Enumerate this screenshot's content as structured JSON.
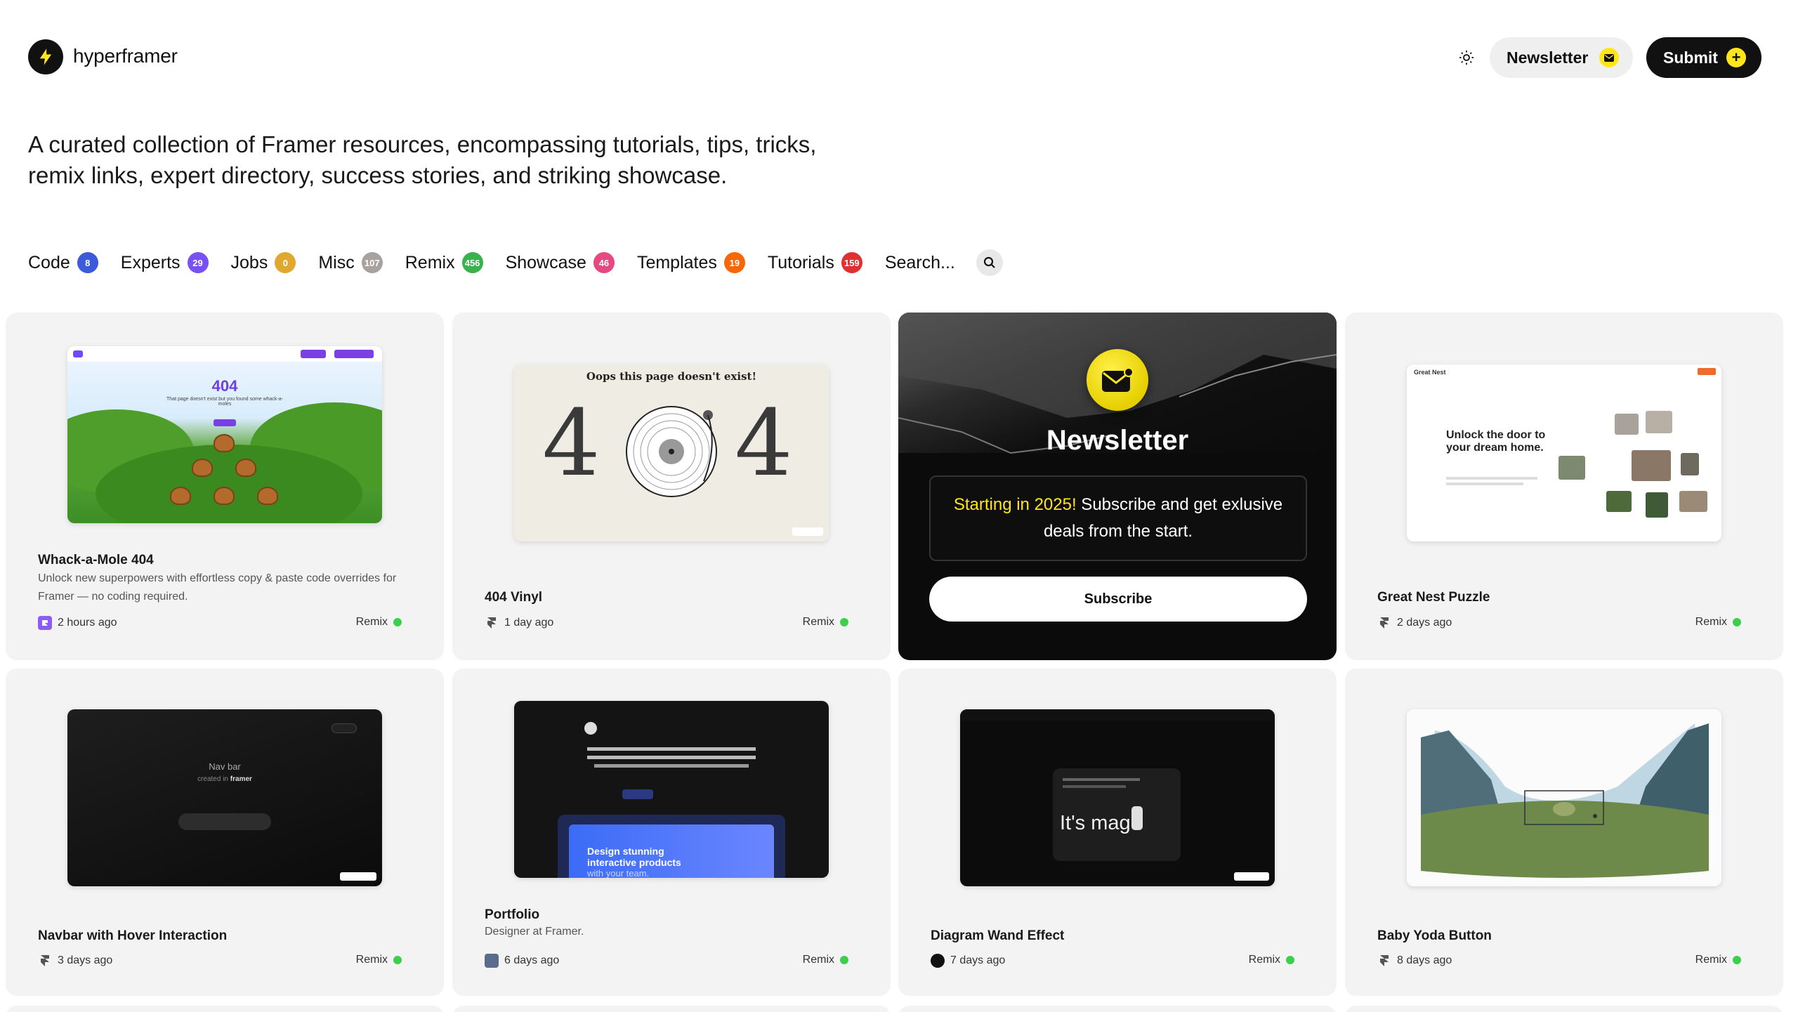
{
  "header": {
    "brand": "hyperframer",
    "newsletter_label": "Newsletter",
    "submit_label": "Submit"
  },
  "tagline": "A curated collection of Framer resources, encompassing tutorials, tips, tricks, remix links, expert directory, success stories, and striking showcase.",
  "filters": [
    {
      "label": "Code",
      "count": "8",
      "color": "#3b5bdb"
    },
    {
      "label": "Experts",
      "count": "29",
      "color": "#7950f2"
    },
    {
      "label": "Jobs",
      "count": "0",
      "color": "#e0a82e"
    },
    {
      "label": "Misc",
      "count": "107",
      "color": "#a8a29e"
    },
    {
      "label": "Remix",
      "count": "456",
      "color": "#37b24d"
    },
    {
      "label": "Showcase",
      "count": "46",
      "color": "#e64980"
    },
    {
      "label": "Templates",
      "count": "19",
      "color": "#f76707"
    },
    {
      "label": "Tutorials",
      "count": "159",
      "color": "#e03131"
    }
  ],
  "search": {
    "label": "Search..."
  },
  "newsletter_card": {
    "title": "Newsletter",
    "highlight": "Starting in 2025!",
    "body": " Subscribe and get exlusive deals from the start.",
    "button": "Subscribe"
  },
  "cards": [
    {
      "title": "Whack-a-Mole 404",
      "desc": "Unlock new superpowers with effortless copy & paste code overrides for Framer — no coding required.",
      "time": "2 hours ago",
      "tag": "Remix"
    },
    {
      "title": "404 Vinyl",
      "desc": "",
      "time": "1 day ago",
      "tag": "Remix"
    },
    {
      "title": "Great Nest Puzzle",
      "desc": "",
      "time": "2 days ago",
      "tag": "Remix"
    },
    {
      "title": "Navbar with Hover Interaction",
      "desc": "",
      "time": "3 days ago",
      "tag": "Remix"
    },
    {
      "title": "Portfolio",
      "desc": "Designer at Framer.",
      "time": "6 days ago",
      "tag": "Remix"
    },
    {
      "title": "Diagram Wand Effect",
      "desc": "",
      "time": "7 days ago",
      "tag": "Remix"
    },
    {
      "title": "Baby Yoda Button",
      "desc": "",
      "time": "8 days ago",
      "tag": "Remix"
    }
  ],
  "thumbs": {
    "whack": {
      "heading": "404",
      "line": "That page doesn't exist but you found some whack-a-moles"
    },
    "vinyl": {
      "heading": "Oops this page doesn't exist!",
      "big_left": "4",
      "big_right": "4"
    },
    "puzzle": {
      "brand": "Great Nest",
      "heading": "Unlock the door to your dream home."
    },
    "navbar": {
      "line1": "Nav bar",
      "line2": "created in",
      "line3": "framer"
    },
    "portfolio": {
      "headline": "Design stunning interactive products",
      "sub": "with your team."
    },
    "wand": {
      "text": "It's mag"
    }
  }
}
